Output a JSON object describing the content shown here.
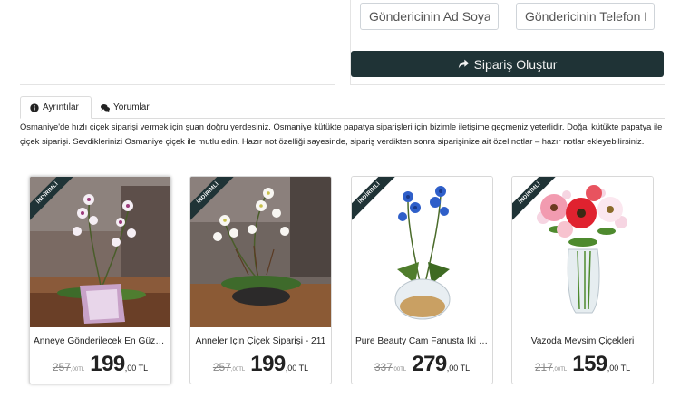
{
  "form": {
    "sender_name_placeholder": "Göndericinin Ad Soyadı",
    "sender_phone_placeholder": "Göndericinin Telefon Numarası",
    "submit_label": "Sipariş Oluştur"
  },
  "tabs": [
    {
      "label": "Ayrıntılar",
      "icon": "info-circle-icon"
    },
    {
      "label": "Yorumlar",
      "icon": "comments-icon"
    }
  ],
  "description": "Osmaniye'de hızlı çiçek siparişi vermek için şuan doğru yerdesiniz. Osmaniye kütükte papatya siparişleri için bizimle iletişime geçmeniz yeterlidir. Doğal kütükte papatya ile çiçek siparişi. Sevdiklerinizi Osmaniye çiçek ile mutlu edin. Hazır not özelliği sayesinde, sipariş verdikten sonra siparişinize ait özel notlar – hazır notlar ekleyebilirsiniz.",
  "badge_label": "İNDİRİMLİ",
  "colors": {
    "accent": "#1f3336"
  },
  "products": [
    {
      "name": "Anneye Gönderilecek En Güzel Orkide",
      "old_price": "257",
      "old_decimals": ",00TL",
      "new_price": "199",
      "new_decimals": ",00 TL"
    },
    {
      "name": "Anneler İçin Çiçek Siparişi - 211",
      "old_price": "257",
      "old_decimals": ",00TL",
      "new_price": "199",
      "new_decimals": ",00 TL"
    },
    {
      "name": "Pure Beauty Cam Fanusta İki Dallı Orkide",
      "old_price": "337",
      "old_decimals": ",00TL",
      "new_price": "279",
      "new_decimals": ",00 TL"
    },
    {
      "name": "Vazoda Mevsim Çiçekleri",
      "old_price": "217",
      "old_decimals": ",00TL",
      "new_price": "159",
      "new_decimals": ",00 TL"
    }
  ]
}
